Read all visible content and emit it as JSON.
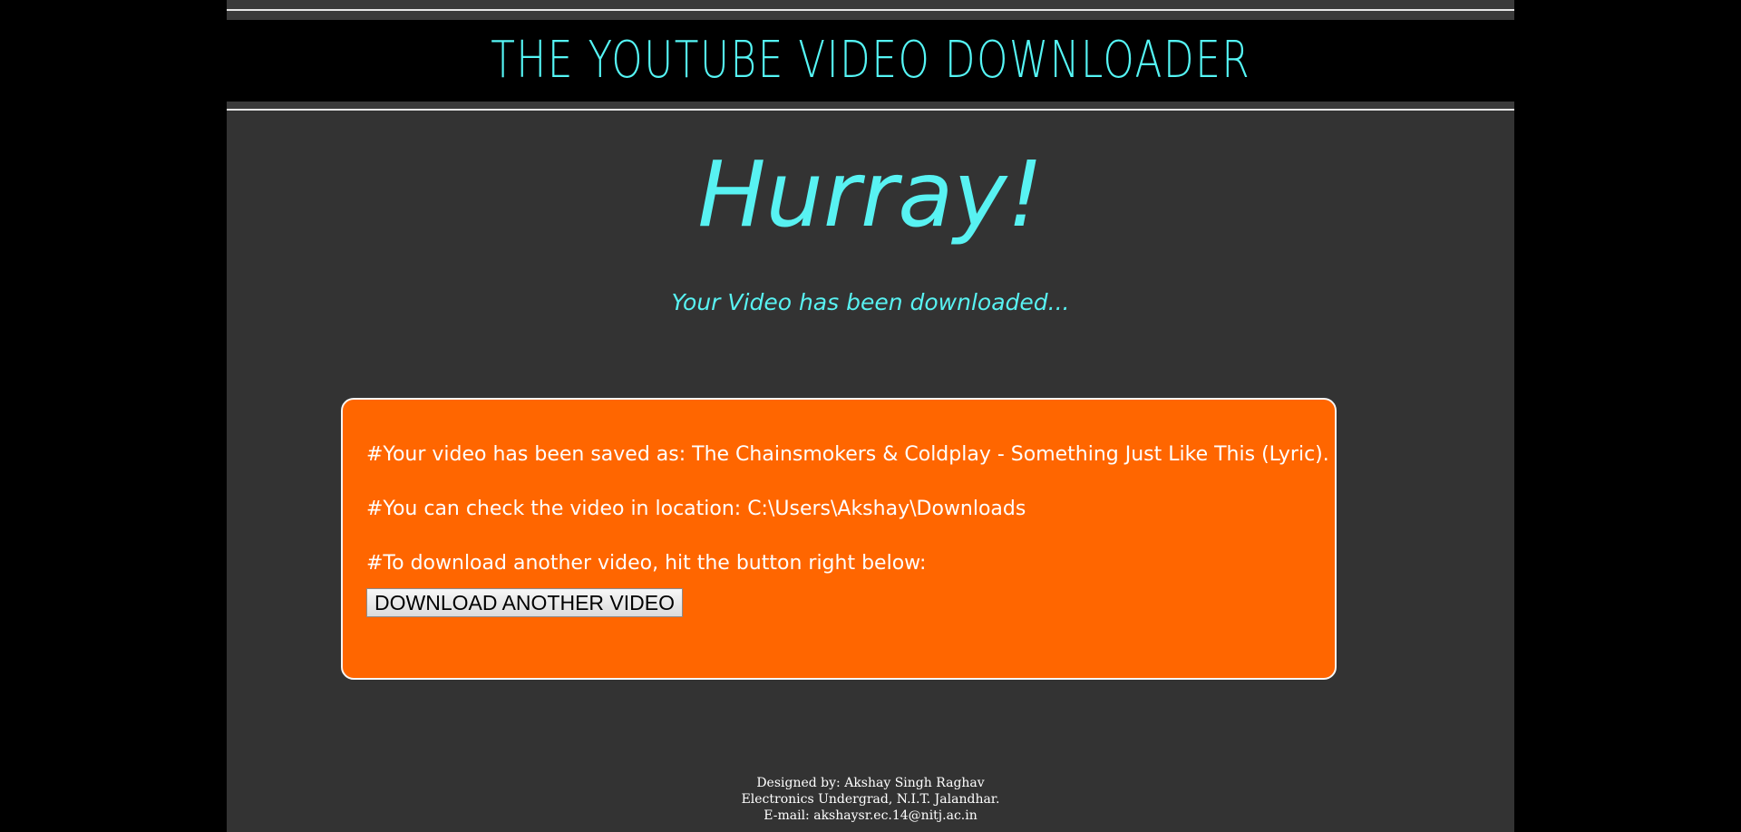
{
  "header": {
    "title": "THE YOUTUBE VIDEO DOWNLOADER"
  },
  "hero": {
    "heading": "Hurray!",
    "subheading": "Your Video has been downloaded..."
  },
  "message_box": {
    "saved_as": "#Your video has been saved as: The Chainsmokers & Coldplay - Something Just Like This (Lyric).",
    "location": "#You can check the video in location: C:\\Users\\Akshay\\Downloads",
    "instruction": "#To download another video, hit the button right below:",
    "button_label": "DOWNLOAD ANOTHER VIDEO"
  },
  "footer": {
    "designer": "Designed by: Akshay Singh Raghav",
    "affiliation": "Electronics Undergrad, N.I.T. Jalandhar.",
    "email": "E-mail: akshaysr.ec.14@nitj.ac.in"
  },
  "colors": {
    "page_background": "#000000",
    "content_background": "#333333",
    "accent": "#55f5f5",
    "message_box": "#ff6600"
  }
}
